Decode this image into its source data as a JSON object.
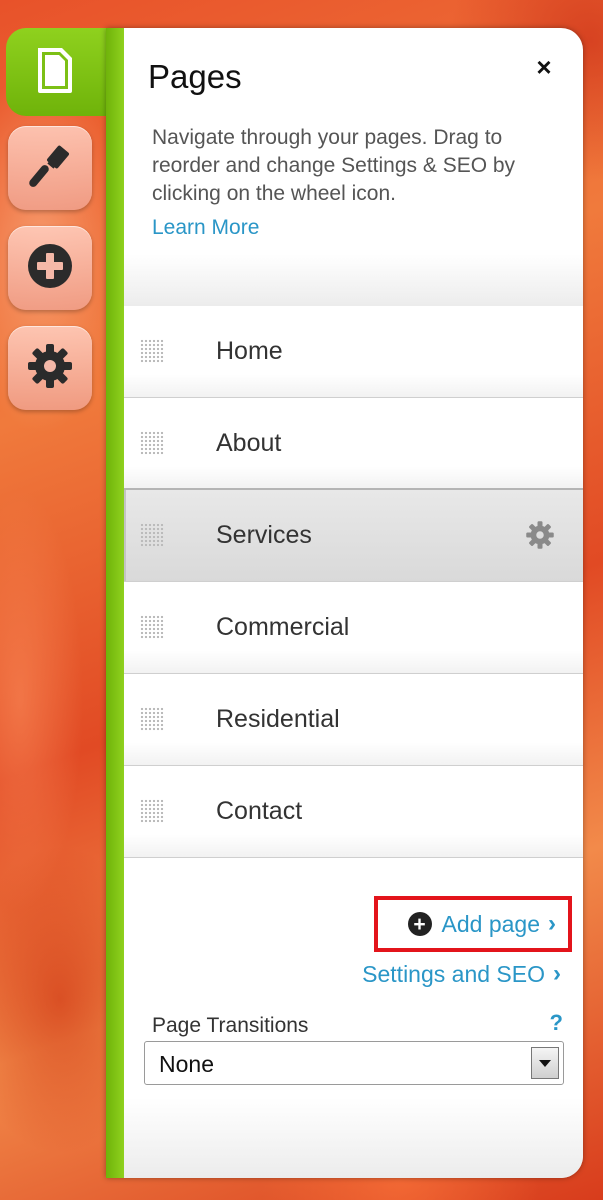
{
  "toolbar": {
    "tabs": [
      {
        "icon": "page-icon",
        "active": true
      },
      {
        "icon": "brush-icon",
        "active": false
      },
      {
        "icon": "add-circle-icon",
        "active": false
      },
      {
        "icon": "gear-icon",
        "active": false
      }
    ]
  },
  "panel": {
    "title": "Pages",
    "close_label": "×",
    "description": "Navigate through your pages. Drag to reorder and change Settings & SEO by clicking on the wheel icon.",
    "learn_more": "Learn More"
  },
  "pages": [
    {
      "name": "Home",
      "selected": false
    },
    {
      "name": "About",
      "selected": false
    },
    {
      "name": "Services",
      "selected": true
    },
    {
      "name": "Commercial",
      "selected": false
    },
    {
      "name": "Residential",
      "selected": false
    },
    {
      "name": "Contact",
      "selected": false
    }
  ],
  "actions": {
    "add_page": "Add page",
    "settings_seo": "Settings and SEO",
    "chevron": "›"
  },
  "transitions": {
    "label": "Page Transitions",
    "help": "?",
    "selected": "None"
  },
  "colors": {
    "accent_green": "#7cc015",
    "link_blue": "#2a96c7",
    "highlight_red": "#e3141b"
  }
}
